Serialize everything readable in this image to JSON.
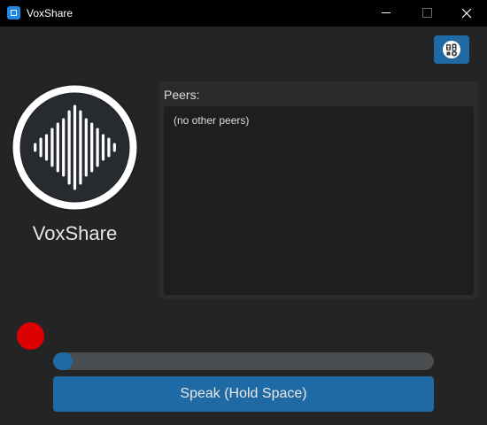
{
  "window": {
    "title": "VoxShare",
    "icon": "app-icon"
  },
  "header": {
    "settings_icon": "audio-settings-icon"
  },
  "logo": {
    "icon": "sound-wave-icon",
    "app_name": "VoxShare"
  },
  "peers": {
    "label": "Peers:",
    "empty_text": "(no other peers)"
  },
  "status": {
    "recording_color": "#dd0000",
    "level": 0.05
  },
  "controls": {
    "speak_label": "Speak (Hold Space)"
  },
  "colors": {
    "accent": "#1f6aa5",
    "background": "#242424",
    "panel": "#2b2b2b"
  }
}
